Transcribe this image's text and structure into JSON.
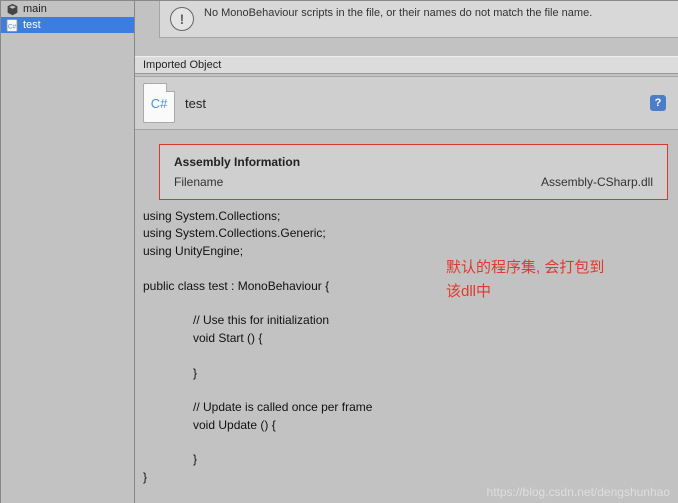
{
  "sidebar": {
    "items": [
      {
        "label": "main",
        "selected": false,
        "icon": "object-icon"
      },
      {
        "label": "test",
        "selected": true,
        "icon": "script-icon"
      }
    ]
  },
  "warning": {
    "text": "No MonoBehaviour scripts in the file, or their names do not match the file name."
  },
  "section": {
    "title": "Imported Object"
  },
  "object": {
    "name": "test",
    "icon_label": "C#"
  },
  "assembly": {
    "title": "Assembly Information",
    "filename_label": "Filename",
    "filename_value": "Assembly-CSharp.dll"
  },
  "code": "using System.Collections;\nusing System.Collections.Generic;\nusing UnityEngine;\n\npublic class test : MonoBehaviour {\n\n               // Use this for initialization\n               void Start () {\n\n               }\n\n               // Update is called once per frame\n               void Update () {\n\n               }\n}",
  "annotation": {
    "line1": "默认的程序集, 会打包到",
    "line2": "该dll中"
  },
  "watermark": "https://blog.csdn.net/dengshunhao"
}
